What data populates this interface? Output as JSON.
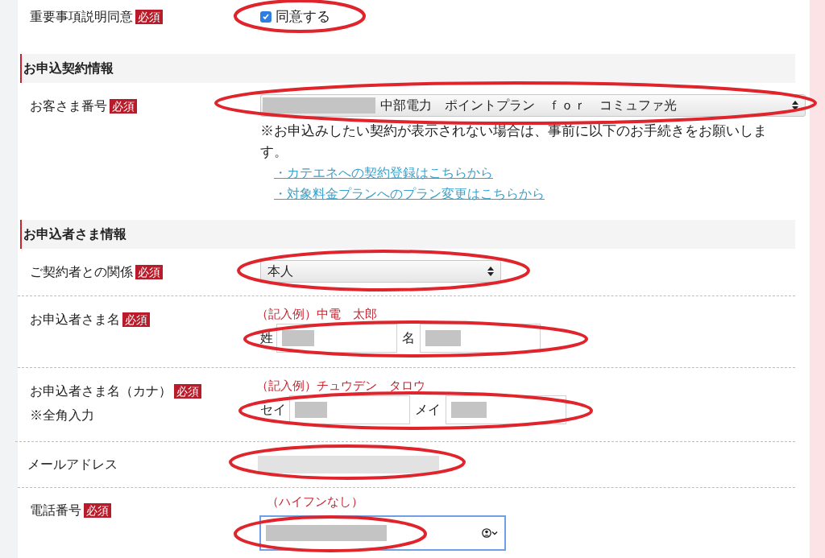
{
  "consent": {
    "label": "重要事項説明同意",
    "badge": "必須",
    "checkbox": {
      "label": "同意する",
      "checked": true
    }
  },
  "sections": [
    {
      "title": "お申込契約情報",
      "rows": [
        {
          "kind": "select",
          "label": "お客さま番号",
          "badge": "必須",
          "value": "中部電力　ポイントプラン　ｆｏｒ　コミュファ光",
          "redacted": true,
          "note": "※お申込みしたい契約が表示されない場合は、事前に以下のお手続きをお願いします。",
          "links": [
            "・カテエネへの契約登録はこちらから",
            "・対象料金プランへのプラン変更はこちらから"
          ]
        }
      ]
    },
    {
      "title": "お申込者さま情報",
      "rows": [
        {
          "kind": "select",
          "label": "ご契約者との関係",
          "badge": "必須",
          "value": "本人"
        },
        {
          "kind": "name",
          "label": "お申込者さま名",
          "badge": "必須",
          "example": "（記入例）中電　太郎",
          "fields": [
            {
              "prefix": "姓",
              "redacted": true
            },
            {
              "prefix": "名",
              "redacted": true
            }
          ]
        },
        {
          "kind": "name",
          "label": "お申込者さま名（カナ）",
          "badge": "必須",
          "sublabel": "※全角入力",
          "example": "（記入例）チュウデン　タロウ",
          "fields": [
            {
              "prefix": "セイ",
              "redacted": true
            },
            {
              "prefix": "メイ",
              "redacted": true
            }
          ]
        },
        {
          "kind": "text",
          "label": "メールアドレス",
          "redacted": true
        },
        {
          "kind": "tel",
          "label": "電話番号",
          "badge": "必須",
          "example": "（ハイフンなし）",
          "redacted": true,
          "focused": true
        }
      ]
    }
  ]
}
